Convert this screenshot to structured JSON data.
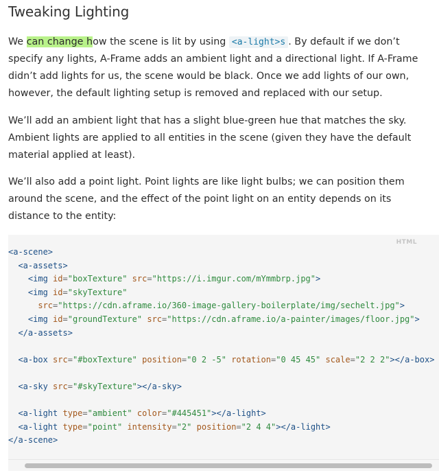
{
  "heading": "Tweaking Lighting",
  "p1": {
    "pre": "We ",
    "highlight": "can change h",
    "mid": "ow the scene is lit by using ",
    "code": "<a-light>s",
    "post": ". By default if we don’t specify any lights, A-Frame adds an ambient light and a directional light. If A-Frame didn’t add lights for us, the scene would be black. Once we add lights of our own, however, the default lighting setup is removed and replaced with our setup."
  },
  "p2": "We’ll add an ambient light that has a slight blue-green hue that matches the sky. Ambient lights are applied to all entities in the scene (given they have the default material applied at least).",
  "p3": "We’ll also add a point light. Point lights are like light bulbs; we can position them around the scene, and the effect of the point light on an entity depends on its distance to the entity:",
  "code_block": {
    "language": "HTML",
    "lines": [
      "<a-scene>",
      "  <a-assets>",
      "    <img id=\"boxTexture\" src=\"https://i.imgur.com/mYmmbrp.jpg\">",
      "    <img id=\"skyTexture\"",
      "      src=\"https://cdn.aframe.io/360-image-gallery-boilerplate/img/sechelt.jpg\">",
      "    <img id=\"groundTexture\" src=\"https://cdn.aframe.io/a-painter/images/floor.jpg\">",
      "  </a-assets>",
      "",
      "  <a-box src=\"#boxTexture\" position=\"0 2 -5\" rotation=\"0 45 45\" scale=\"2 2 2\"></a-box>",
      "",
      "  <a-sky src=\"#skyTexture\"></a-sky>",
      "",
      "  <a-light type=\"ambient\" color=\"#445451\"></a-light>",
      "  <a-light type=\"point\" intensity=\"2\" position=\"2 4 4\"></a-light>",
      "</a-scene>"
    ]
  }
}
